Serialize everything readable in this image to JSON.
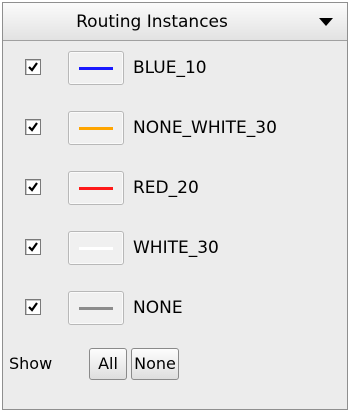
{
  "header": {
    "title": "Routing Instances"
  },
  "instances": [
    {
      "name": "BLUE_10",
      "checked": true,
      "color": "#1a1aff"
    },
    {
      "name": "NONE_WHITE_30",
      "checked": true,
      "color": "#ffa500"
    },
    {
      "name": "RED_20",
      "checked": true,
      "color": "#ff1a1a"
    },
    {
      "name": "WHITE_30",
      "checked": true,
      "color": "#ffffff"
    },
    {
      "name": "NONE",
      "checked": true,
      "color": "#8c8c8c"
    }
  ],
  "footer": {
    "show_label": "Show",
    "all_label": "All",
    "none_label": "None"
  }
}
